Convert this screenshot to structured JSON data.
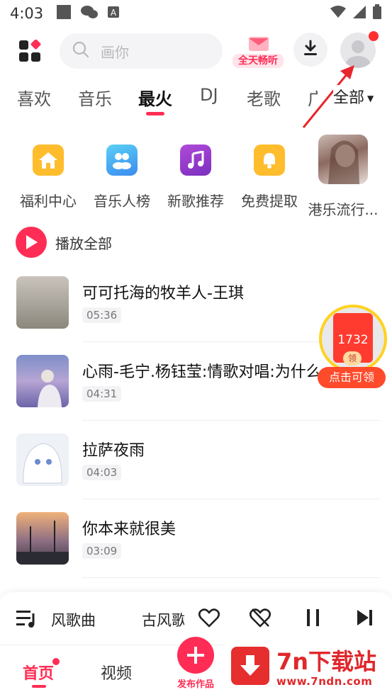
{
  "status_bar": {
    "time": "4:03"
  },
  "search": {
    "placeholder": "画你"
  },
  "vip": {
    "label": "全天畅听"
  },
  "tabs": [
    {
      "label": "喜欢"
    },
    {
      "label": "音乐"
    },
    {
      "label": "最火"
    },
    {
      "label": "DJ"
    },
    {
      "label": "老歌"
    },
    {
      "label": "广"
    }
  ],
  "tabs_more": {
    "label": "全部"
  },
  "shortcuts": [
    {
      "label": "福利中心",
      "icon": "home-icon",
      "color": "#ffb020"
    },
    {
      "label": "音乐人榜",
      "icon": "users-icon",
      "color": "#3db4f2"
    },
    {
      "label": "新歌推荐",
      "icon": "music-note-icon",
      "color": "#8e44ad"
    },
    {
      "label": "免费提取",
      "icon": "bell-icon",
      "color": "#ffb020"
    },
    {
      "label": "港乐流行...",
      "icon": "photo",
      "color": "#b08c80"
    }
  ],
  "play_all": {
    "label": "播放全部"
  },
  "songs": [
    {
      "title": "可可托海的牧羊人-王琪",
      "duration": "05:36"
    },
    {
      "title": "心雨-毛宁.杨钰莹:情歌对唱:为什么",
      "duration": "04:31"
    },
    {
      "title": "拉萨夜雨",
      "duration": "04:03"
    },
    {
      "title": "你本来就很美",
      "duration": "03:09"
    }
  ],
  "coin_widget": {
    "count": "1732",
    "badge": "领",
    "button": "点击可领"
  },
  "player": {
    "title": "风歌曲",
    "title2": "古风歌"
  },
  "bottom_nav": {
    "home": "首页",
    "video": "视频",
    "publish": "发布作品"
  },
  "watermark": {
    "title": "7n下载站",
    "url": "www.7ndn.com"
  },
  "colors": {
    "accent": "#ff2d55",
    "watermark": "#e0282c"
  }
}
